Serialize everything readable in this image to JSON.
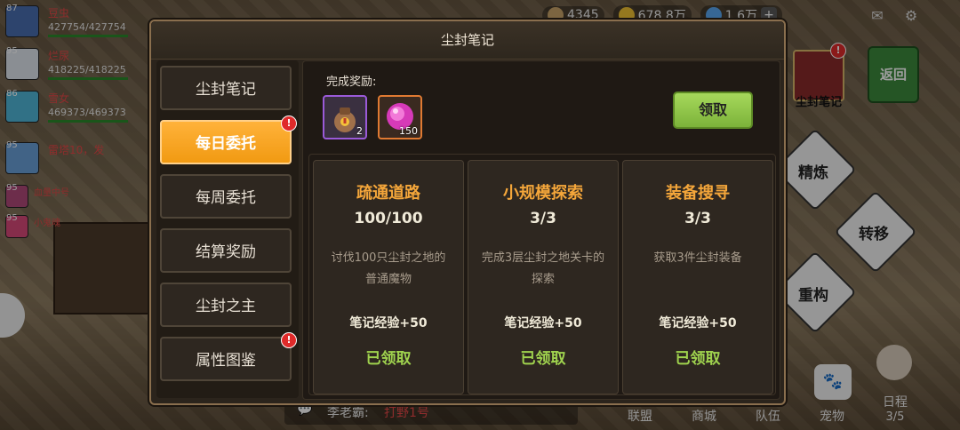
{
  "top": {
    "res1": "4345",
    "gold": "678.8万",
    "gem": "1.6万"
  },
  "party": [
    {
      "level": "87",
      "name": "豆虫",
      "hp": "427754/427754"
    },
    {
      "level": "95",
      "name": "烂尿",
      "hp": "418225/418225"
    },
    {
      "level": "86",
      "name": "雪女",
      "hp": "469373/469373"
    },
    {
      "level": "95",
      "name": "雷塔10，发"
    },
    {
      "level": "95",
      "name": "血量中号"
    },
    {
      "level": "95",
      "name": "小鬼魂"
    }
  ],
  "right": {
    "notebook_label": "尘封笔记",
    "back_label": "返回",
    "refine": "精炼",
    "transfer": "转移",
    "rebuild": "重构"
  },
  "bottom": {
    "chat_name": "李老霸:",
    "chat_text": "打野1号",
    "alliance": "联盟",
    "shop": "商城",
    "team": "队伍",
    "pet": "宠物",
    "schedule": "日程",
    "schedule_progress": "3/5"
  },
  "modal": {
    "title": "尘封笔记",
    "tabs": [
      {
        "label": "尘封笔记",
        "active": false,
        "badge": false
      },
      {
        "label": "每日委托",
        "active": true,
        "badge": true
      },
      {
        "label": "每周委托",
        "active": false,
        "badge": false
      },
      {
        "label": "结算奖励",
        "active": false,
        "badge": false
      },
      {
        "label": "尘封之主",
        "active": false,
        "badge": false
      },
      {
        "label": "属性图鉴",
        "active": false,
        "badge": true
      }
    ],
    "badge_mark": "!",
    "reward_label": "完成奖励:",
    "rewards": [
      {
        "icon": "treasure-bag-icon",
        "count": "2"
      },
      {
        "icon": "pink-orb-icon",
        "count": "150"
      }
    ],
    "claim_label": "领取",
    "tasks": [
      {
        "title": "疏通道路",
        "progress": "100/100",
        "desc": "讨伐100只尘封之地的普通魔物",
        "reward": "笔记经验+50",
        "status": "已领取"
      },
      {
        "title": "小规模探索",
        "progress": "3/3",
        "desc": "完成3层尘封之地关卡的探索",
        "reward": "笔记经验+50",
        "status": "已领取"
      },
      {
        "title": "装备搜寻",
        "progress": "3/3",
        "desc": "获取3件尘封装备",
        "reward": "笔记经验+50",
        "status": "已领取"
      }
    ]
  },
  "colors": {
    "accent_orange": "#f19a12",
    "title_orange": "#f4a63a",
    "claimed_green": "#9fd24e",
    "claim_button": "#8bc34a"
  }
}
